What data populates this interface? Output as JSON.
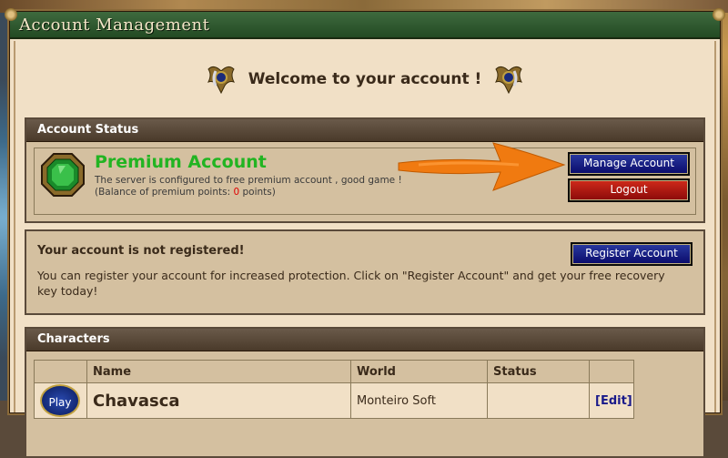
{
  "window": {
    "title": "Account Management"
  },
  "welcome": {
    "heading": "Welcome to your account !"
  },
  "account_status": {
    "header": "Account Status",
    "premium_title": "Premium Account",
    "desc_line1": "The server is configured to free premium account , good game !",
    "desc_line2_prefix": "(Balance of premium points: ",
    "premium_points": "0",
    "desc_line2_suffix": " points)",
    "manage_button": "Manage Account",
    "logout_button": "Logout"
  },
  "registration": {
    "title": "Your account is not registered!",
    "text": "You can register your account for increased protection. Click on \"Register Account\" and get your free recovery key today!",
    "register_button": "Register Account"
  },
  "characters": {
    "header": "Characters",
    "columns": [
      "Name",
      "World",
      "Status"
    ],
    "rows": [
      {
        "play_label": "Play",
        "name": "Chavasca",
        "world": "Monteiro Soft",
        "status": "",
        "edit_label": "[Edit]"
      }
    ]
  },
  "colors": {
    "title_bar": "#2e5a2e",
    "premium_green": "#22b422",
    "button_blue": "#0a1a80",
    "button_red": "#b01a1a",
    "arrow_orange": "#f07a10"
  }
}
